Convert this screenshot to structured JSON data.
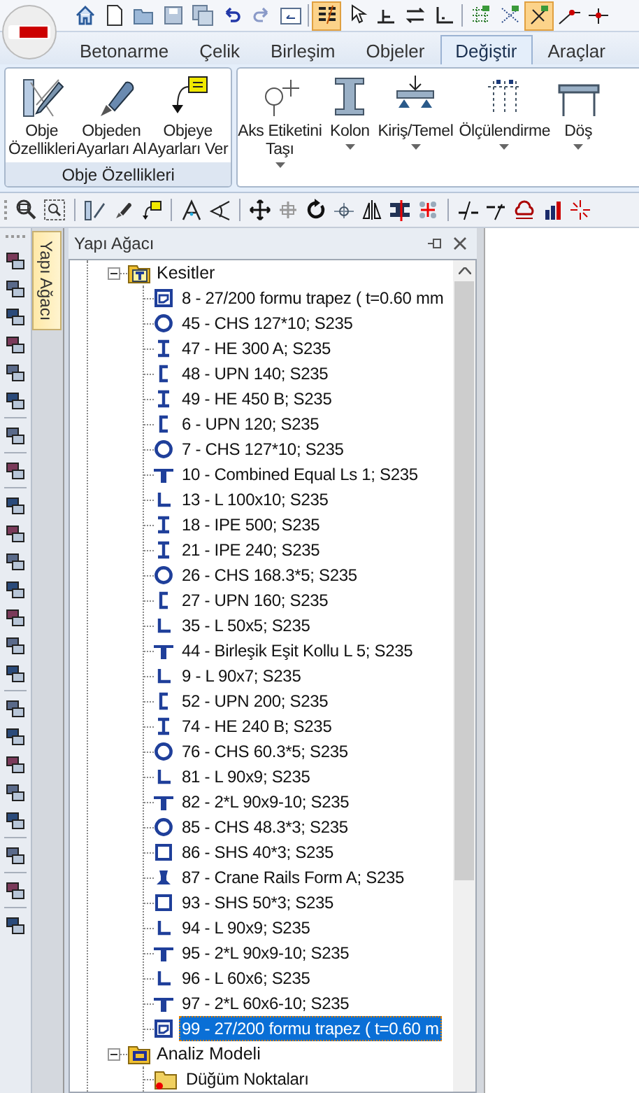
{
  "quick_access_toolbar": [
    {
      "on": false
    },
    {
      "on": false
    },
    {
      "on": false
    },
    {
      "on": false
    },
    {
      "on": false
    },
    {
      "on": false
    },
    {
      "on": false
    },
    {
      "on": false
    },
    {
      "on": true
    },
    {
      "on": false
    },
    {
      "on": false
    },
    {
      "on": false
    },
    {
      "on": false
    },
    {
      "on": false
    },
    {
      "on": false
    },
    {
      "on": true
    },
    {
      "on": false
    },
    {
      "on": false
    }
  ],
  "tabs": [
    {
      "label": "Betonarme",
      "selected": false
    },
    {
      "label": "Çelik",
      "selected": false
    },
    {
      "label": "Birleşim",
      "selected": false
    },
    {
      "label": "Objeler",
      "selected": false
    },
    {
      "label": "Değiştir",
      "selected": true
    },
    {
      "label": "Araçlar",
      "selected": false
    }
  ],
  "ribbon_groups": [
    {
      "title": "Obje Özellikleri",
      "buttons": [
        {
          "lines": [
            "Obje",
            "Özellikleri"
          ],
          "dropdown": false
        },
        {
          "lines": [
            "Objeden",
            "Ayarları Al"
          ],
          "dropdown": false
        },
        {
          "lines": [
            "Objeye",
            "Ayarları Ver"
          ],
          "dropdown": false
        }
      ]
    },
    {
      "buttons": [
        {
          "lines": [
            "Aks Etiketini",
            "Taşı"
          ],
          "dropdown": true
        },
        {
          "lines": [
            "Kolon"
          ],
          "dropdown": true
        },
        {
          "lines": [
            "Kiriş/Temel"
          ],
          "dropdown": true
        },
        {
          "lines": [
            "Ölçülendirme"
          ],
          "dropdown": true
        },
        {
          "lines": [
            "Döş"
          ],
          "dropdown": true
        }
      ]
    }
  ],
  "side_tabs": [
    {
      "label": "Yapı Ağacı",
      "selected": true
    }
  ],
  "panel": {
    "title": "Yapı Ağacı"
  },
  "tree": [
    {
      "label": "Kesitler",
      "kind": "sections",
      "expanded": true,
      "children": [
        {
          "label": "8 - 27/200 formu trapez ( t=0.60 mm",
          "kind": "deck",
          "selected": false
        },
        {
          "label": "45 - CHS 127*10; S235",
          "kind": "circle",
          "selected": false
        },
        {
          "label": "47 - HE 300 A; S235",
          "kind": "ibeam",
          "selected": false
        },
        {
          "label": "48 - UPN 140; S235",
          "kind": "channel",
          "selected": false
        },
        {
          "label": "49 - HE 450 B; S235",
          "kind": "ibeam",
          "selected": false
        },
        {
          "label": "6 - UPN 120; S235",
          "kind": "channel",
          "selected": false
        },
        {
          "label": "7 - CHS 127*10; S235",
          "kind": "circle",
          "selected": false
        },
        {
          "label": "10 - Combined Equal Ls 1; S235",
          "kind": "double-angle",
          "selected": false
        },
        {
          "label": "13 - L 100x10; S235",
          "kind": "angle",
          "selected": false
        },
        {
          "label": "18 - IPE 500; S235",
          "kind": "ibeam",
          "selected": false
        },
        {
          "label": "21 - IPE 240; S235",
          "kind": "ibeam",
          "selected": false
        },
        {
          "label": "26 - CHS 168.3*5; S235",
          "kind": "circle",
          "selected": false
        },
        {
          "label": "27 - UPN 160; S235",
          "kind": "channel",
          "selected": false
        },
        {
          "label": "35 - L 50x5; S235",
          "kind": "angle",
          "selected": false
        },
        {
          "label": "44 - Birleşik Eşit Kollu L 5; S235",
          "kind": "double-angle",
          "selected": false
        },
        {
          "label": "9 - L 90x7; S235",
          "kind": "angle",
          "selected": false
        },
        {
          "label": "52 - UPN 200; S235",
          "kind": "channel",
          "selected": false
        },
        {
          "label": "74 - HE 240 B; S235",
          "kind": "ibeam",
          "selected": false
        },
        {
          "label": "76 - CHS 60.3*5; S235",
          "kind": "circle",
          "selected": false
        },
        {
          "label": "81 - L 90x9; S235",
          "kind": "angle",
          "selected": false
        },
        {
          "label": "82 - 2*L 90x9-10; S235",
          "kind": "double-angle",
          "selected": false
        },
        {
          "label": "85 - CHS 48.3*3; S235",
          "kind": "circle",
          "selected": false
        },
        {
          "label": "86 - SHS 40*3; S235",
          "kind": "square",
          "selected": false
        },
        {
          "label": "87 - Crane Rails Form A; S235",
          "kind": "rail",
          "selected": false
        },
        {
          "label": "93 - SHS 50*3; S235",
          "kind": "square",
          "selected": false
        },
        {
          "label": "94 - L 90x9; S235",
          "kind": "angle",
          "selected": false
        },
        {
          "label": "95 - 2*L 90x9-10; S235",
          "kind": "double-angle",
          "selected": false
        },
        {
          "label": "96 - L 60x6; S235",
          "kind": "angle",
          "selected": false
        },
        {
          "label": "97 - 2*L 60x6-10; S235",
          "kind": "double-angle",
          "selected": false
        },
        {
          "label": "99 - 27/200 formu trapez ( t=0.60 m",
          "kind": "deck",
          "selected": true
        }
      ]
    },
    {
      "label": "Analiz Modeli",
      "kind": "analysis",
      "expanded": true,
      "children": [
        {
          "label": "Düğüm Noktaları",
          "kind": "nodes",
          "selected": false
        }
      ]
    }
  ]
}
